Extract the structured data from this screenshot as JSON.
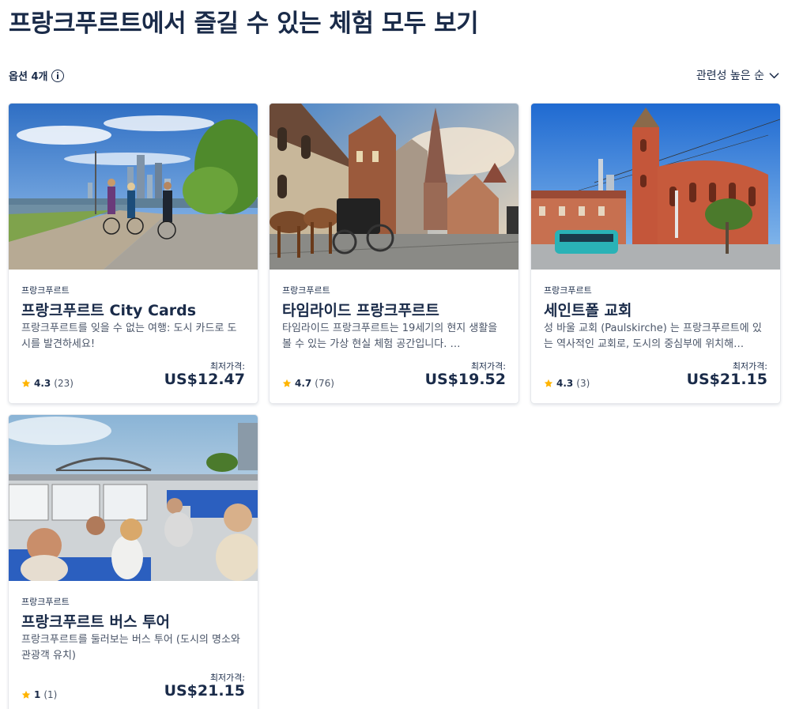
{
  "page": {
    "title": "프랑크푸르트에서 즐길 수 있는 체험 모두 보기",
    "options_label": "옵션 4개",
    "sort_label": "관련성 높은 순"
  },
  "colors": {
    "text": "#1a2b49",
    "star": "#ffb400",
    "muted": "#4a5568"
  },
  "icons": {
    "info": "info-icon",
    "sort": "chevron-down-icon",
    "rating": "star-icon"
  },
  "cards": [
    {
      "location": "프랑크푸르트",
      "title": "프랑크푸르트 City Cards",
      "description": "프랑크푸르트를 잊을 수 없는 여행: 도시 카드로 도시를 발견하세요!",
      "rating": "4.3",
      "reviews": "(23)",
      "price_label": "최저가격:",
      "price": "US$12.47"
    },
    {
      "location": "프랑크푸르트",
      "title": "타임라이드 프랑크푸르트",
      "description": "타임라이드 프랑크푸르트는 19세기의 현지 생활을 볼 수 있는 가상 현실 체험 공간입니다. …",
      "rating": "4.7",
      "reviews": "(76)",
      "price_label": "최저가격:",
      "price": "US$19.52"
    },
    {
      "location": "프랑크푸르트",
      "title": "세인트폴 교회",
      "description": "성 바울 교회 (Paulskirche) 는 프랑크푸르트에 있는 역사적인 교회로, 도시의 중심부에 위치해…",
      "rating": "4.3",
      "reviews": "(3)",
      "price_label": "최저가격:",
      "price": "US$21.15"
    },
    {
      "location": "프랑크푸르트",
      "title": "프랑크푸르트 버스 투어",
      "description": "프랑크푸르트를 둘러보는 버스 투어 (도시의 명소와 관광객 유치)",
      "rating": "1",
      "reviews": "(1)",
      "price_label": "최저가격:",
      "price": "US$21.15"
    }
  ]
}
